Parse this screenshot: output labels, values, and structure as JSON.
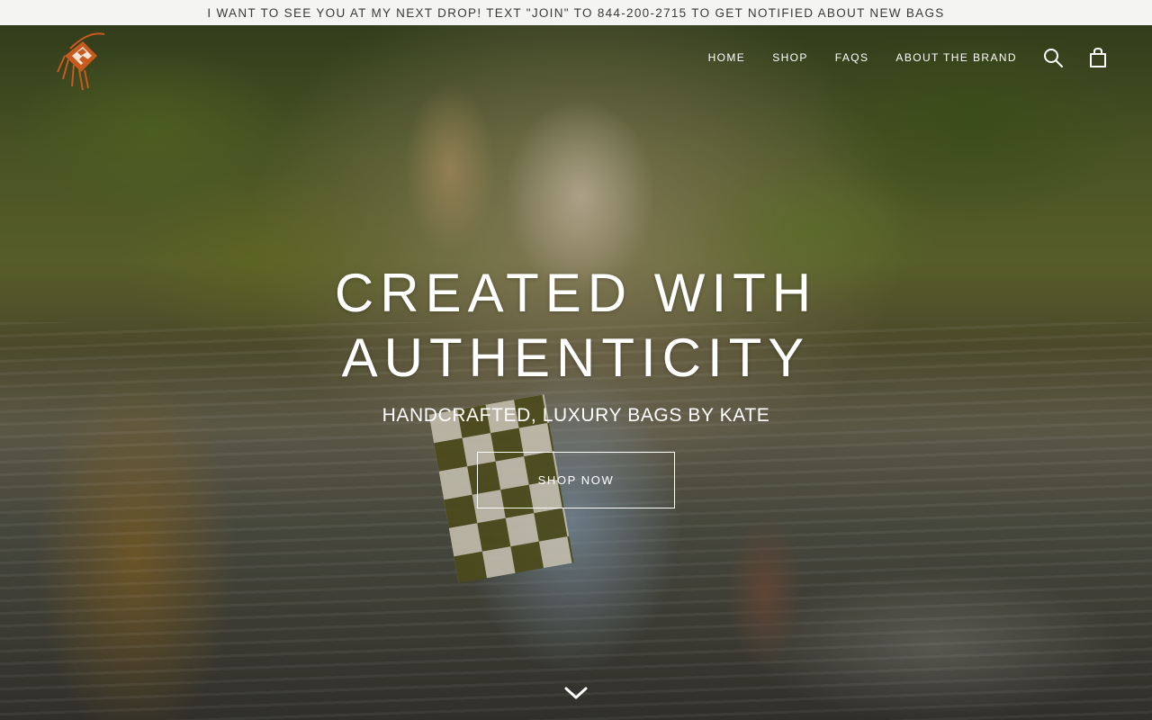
{
  "announcement": {
    "text": "I WANT TO SEE YOU AT MY NEXT DROP! TEXT \"JOIN\" TO 844-200-2715 TO GET NOTIFIED ABOUT NEW BAGS"
  },
  "header": {
    "logo_icon": "tassel-bag-logo",
    "nav": [
      {
        "label": "HOME"
      },
      {
        "label": "SHOP"
      },
      {
        "label": "FAQS"
      },
      {
        "label": "ABOUT THE BRAND"
      }
    ],
    "icons": [
      "search-icon",
      "cart-icon"
    ]
  },
  "hero": {
    "title_line1": "CREATED WITH",
    "title_line2": "AUTHENTICITY",
    "subtitle": "HANDCRAFTED, LUXURY BAGS BY KATE",
    "button_label": "SHOP NOW",
    "scroll_icon": "chevron-down-icon"
  },
  "colors": {
    "announcement_bg": "#f4f4f2",
    "announcement_text": "#3a3a3a",
    "hero_text": "#ffffff",
    "logo_accent": "#c85a1e"
  }
}
